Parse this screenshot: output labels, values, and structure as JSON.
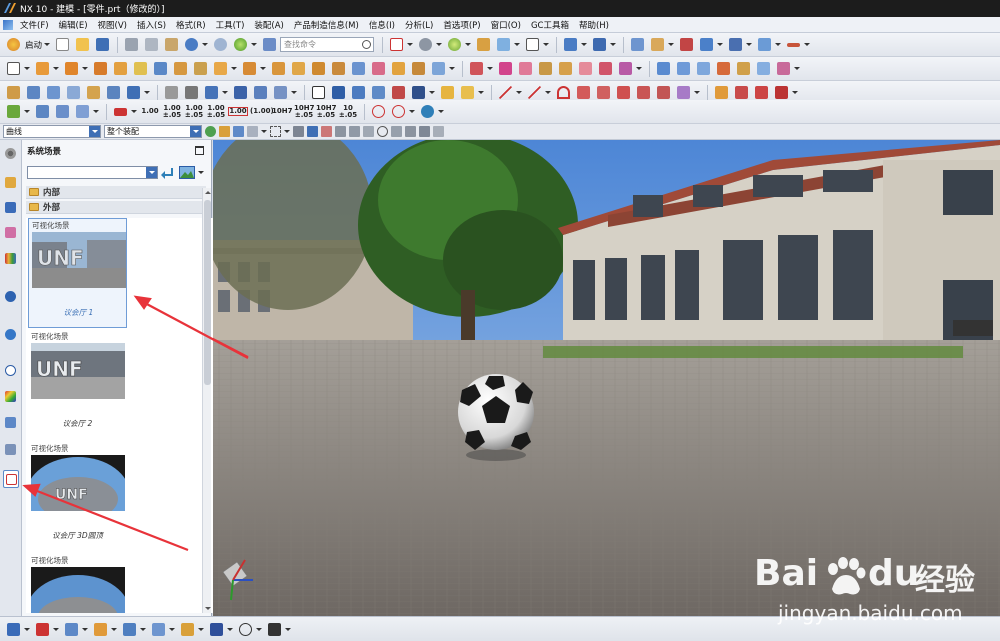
{
  "window": {
    "title": "NX 10 - 建模 - [零件.prt（修改的）]"
  },
  "menu": [
    "文件(F)",
    "编辑(E)",
    "视图(V)",
    "插入(S)",
    "格式(R)",
    "工具(T)",
    "装配(A)",
    "产品制造信息(M)",
    "信息(I)",
    "分析(L)",
    "首选项(P)",
    "窗口(O)",
    "GC工具箱",
    "帮助(H)"
  ],
  "toolbar": {
    "start_label": "启动",
    "command_search_placeholder": "查找命令",
    "tol_labels": [
      "1.00",
      "1.00\n±.05",
      "1.00\n±.05",
      "1.00\n±.05",
      "1.00",
      "(1.00)",
      "10H7",
      "10H7\n±.05",
      "10H7\n±.05",
      "10\n±.05"
    ],
    "ttl_10h7": "10H7"
  },
  "selection_bar": {
    "type_filter": "曲线",
    "scope": "整个装配"
  },
  "panel": {
    "title": "系统场景",
    "folders": [
      "内部",
      "外部"
    ],
    "scenes": [
      {
        "type": "可视化场景",
        "name": "议会厅 1"
      },
      {
        "type": "可视化场景",
        "name": "议会厅 2"
      },
      {
        "type": "可视化场景",
        "name": "议会厅 3D圆顶"
      },
      {
        "type": "可视化场景",
        "name": ""
      }
    ]
  },
  "watermark": {
    "brand": "Bai",
    "du": "du",
    "cn": "经验",
    "url": "jingyan.baidu.com"
  },
  "colors": {
    "accent": "#3f6fb5",
    "annotation_arrow": "#e8333a",
    "title_bg": "#1c1c1c"
  }
}
